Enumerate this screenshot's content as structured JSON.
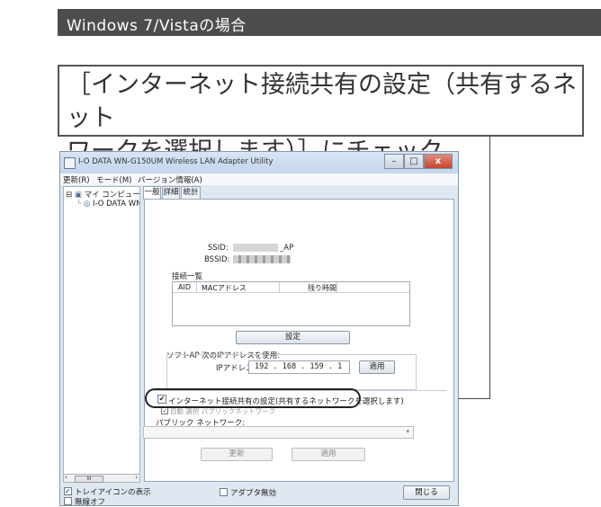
{
  "section_header": "Windows 7/Vistaの場合",
  "callout": {
    "line1": "［インターネット接続共有の設定（共有するネット",
    "line2": "ワークを選択します）］にチェック"
  },
  "window": {
    "title": "I-O DATA WN-G150UM Wireless LAN Adapter Utility",
    "controls": {
      "minimize": "–",
      "maximize": "□",
      "close": "x"
    },
    "menu": [
      "更新(R)",
      "モード(M)",
      "バージョン情報(A)"
    ],
    "tree": {
      "root": "マイ コンピュータ",
      "child": "I-O DATA WN",
      "scroll_label": "III"
    },
    "tabs": [
      "一般",
      "詳細",
      "統計"
    ],
    "ssid_label": "SSID:",
    "ssid_suffix": "_AP",
    "bssid_label": "BSSID:",
    "connection_list_label": "接続一覧",
    "list_columns": [
      "AID",
      "MACアドレス",
      "残り時間"
    ],
    "settings_button": "設定",
    "softap_label": "ソフトAP 次のIPアドレスを使用:",
    "ip_label": "IPアドレス:",
    "ip_value": "192 . 168 . 159 .  1",
    "apply_button_1": "適用",
    "ics_checkbox_label": "インターネット接続共有の設定(共有するネットワークを選択します)",
    "auto_select_label": "自動 選択 パブリックネットワーク",
    "public_network_label": "パブリック ネットワーク:",
    "update_button": "更新",
    "apply_button_2": "適用",
    "tray_icon_label": "トレイアイコンの表示",
    "radio_off_label": "無線オフ",
    "adapter_disable_label": "アダプタ無効",
    "close_button": "閉じる"
  }
}
